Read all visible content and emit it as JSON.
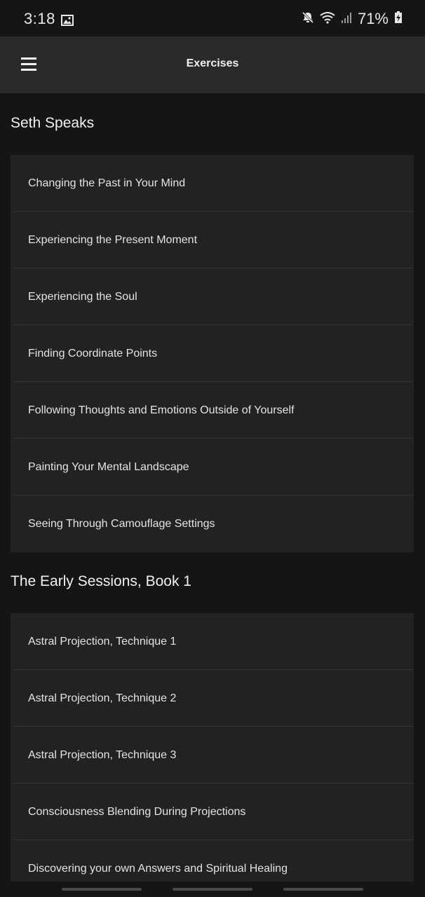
{
  "status_bar": {
    "time": "3:18",
    "battery": "71%",
    "icons": [
      "image-icon",
      "mute-icon",
      "wifi-icon",
      "signal-icon",
      "battery-icon"
    ]
  },
  "app_bar": {
    "title": "Exercises",
    "menu_icon": "hamburger-menu-icon"
  },
  "sections": [
    {
      "title": "Seth Speaks",
      "items": [
        "Changing the Past in Your Mind",
        "Experiencing the Present Moment",
        "Experiencing the Soul",
        "Finding Coordinate Points",
        "Following Thoughts and Emotions Outside of Yourself",
        "Painting Your Mental Landscape",
        "Seeing Through Camouflage Settings"
      ]
    },
    {
      "title": "The Early Sessions, Book 1",
      "items": [
        "Astral Projection, Technique 1",
        "Astral Projection, Technique 2",
        "Astral Projection, Technique 3",
        "Consciousness Blending During Projections",
        "Discovering your own Answers and Spiritual Healing"
      ]
    }
  ],
  "colors": {
    "background": "#151515",
    "app_bar": "#2a2a2a",
    "card": "#222222",
    "divider": "#333333",
    "text": "#e4e4e4"
  }
}
